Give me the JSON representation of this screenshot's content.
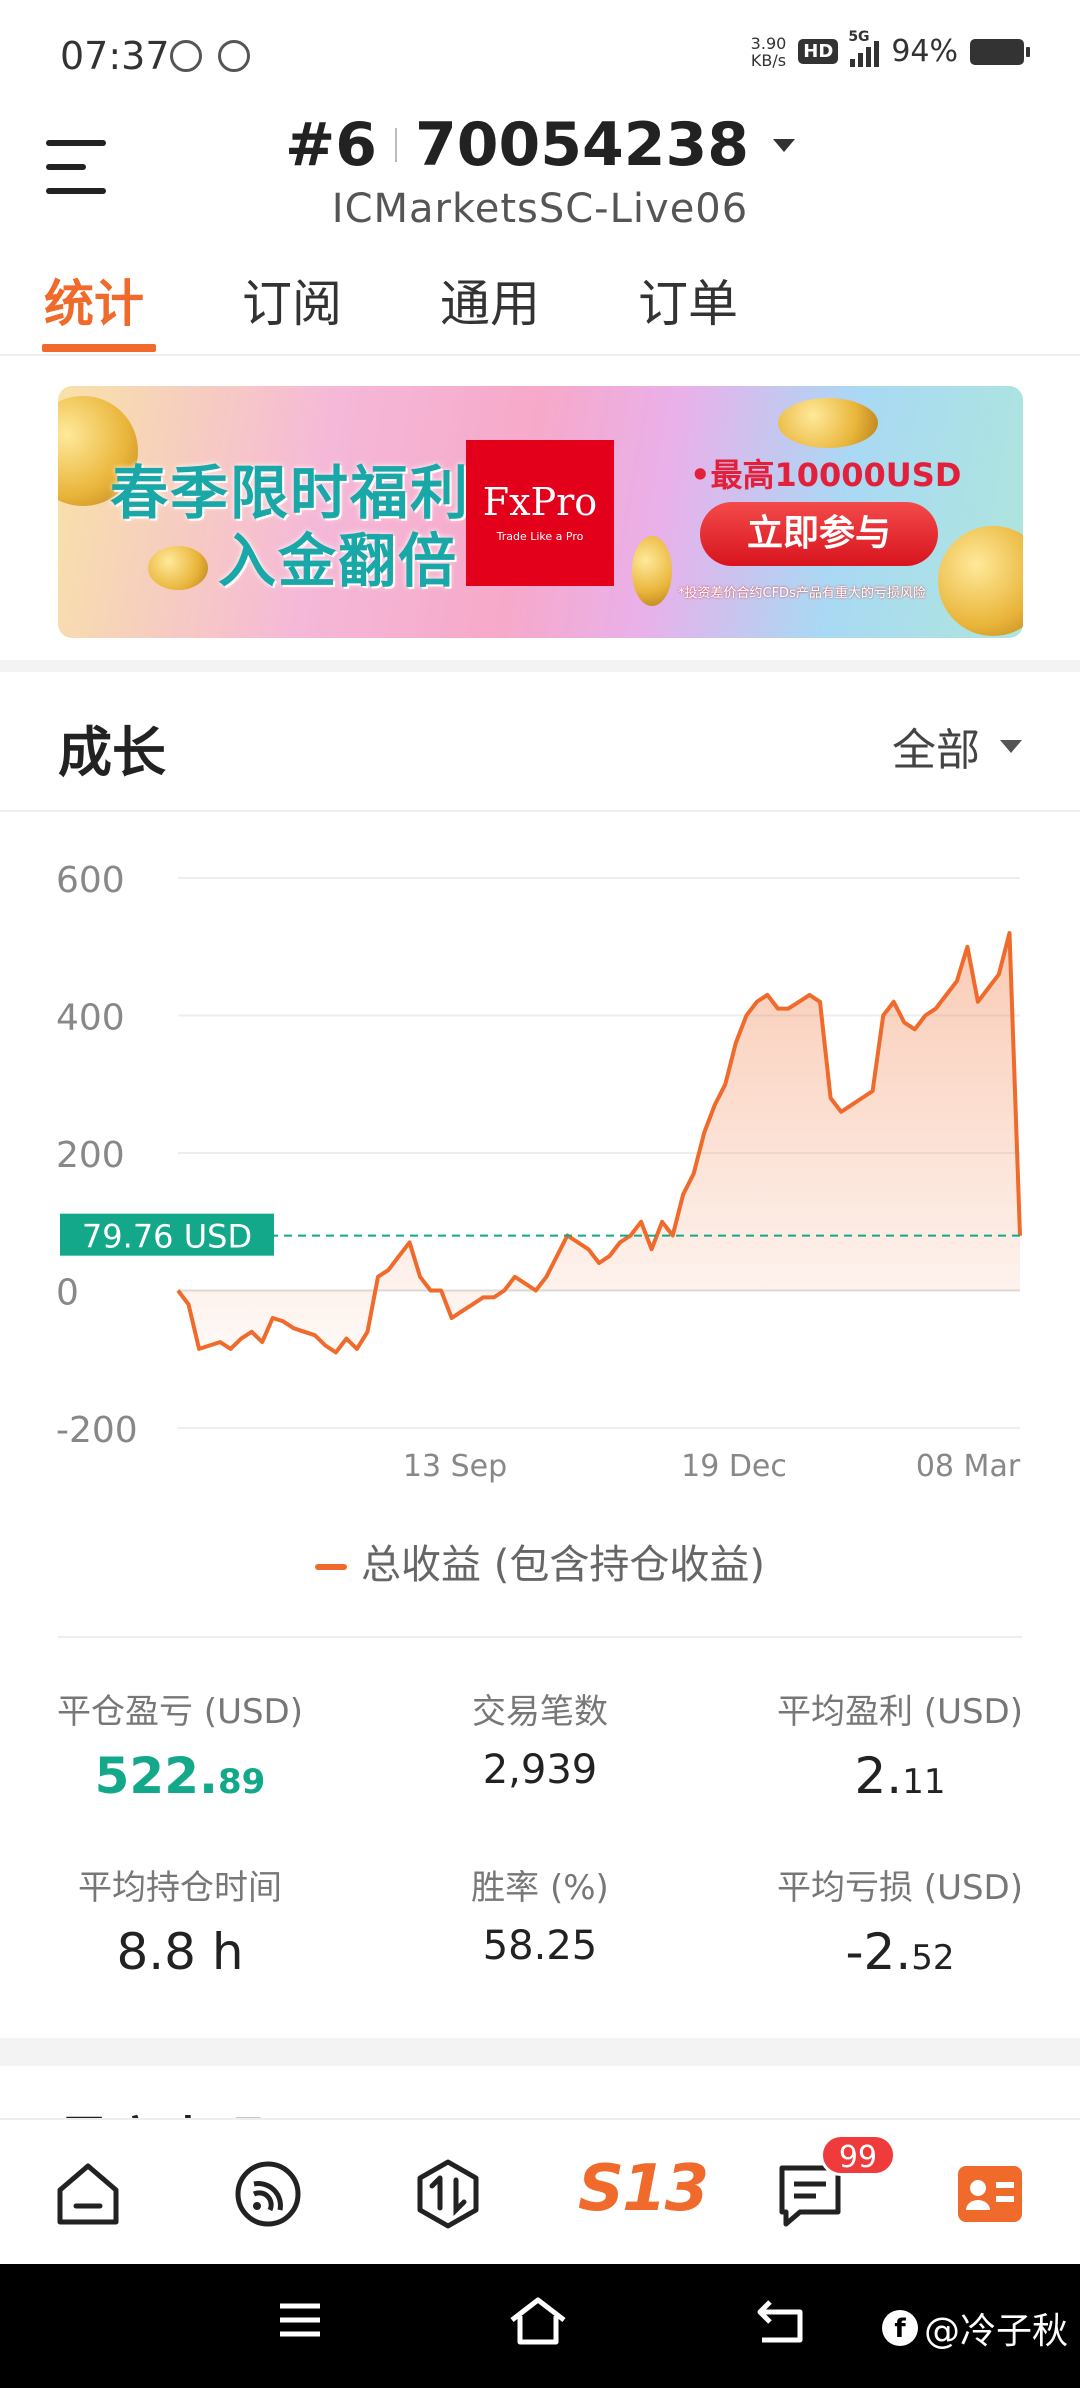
{
  "status_bar": {
    "time": "07:37",
    "net_speed_value": "3.90",
    "net_speed_unit": "KB/s",
    "hd": "HD",
    "network": "5G",
    "battery": "94%"
  },
  "header": {
    "account_prefix": "#6",
    "account_number": "70054238",
    "server": "ICMarketsSC-Live06"
  },
  "tabs": [
    {
      "label": "统计",
      "active": true
    },
    {
      "label": "订阅",
      "active": false
    },
    {
      "label": "通用",
      "active": false
    },
    {
      "label": "订单",
      "active": false
    }
  ],
  "banner": {
    "line1": "春季限时福利",
    "line2": "入金翻倍",
    "brand": "FxPro",
    "brand_tagline": "Trade Like a Pro",
    "promo_top": "•最高10000USD",
    "cta": "立即参与",
    "note": "*投资差价合约CFDs产品有重大的亏损风险"
  },
  "growth": {
    "title": "成长",
    "range": "全部"
  },
  "chart_data": {
    "type": "area",
    "y_ticks": [
      "600",
      "400",
      "200",
      "0",
      "-200"
    ],
    "ylim": [
      -200,
      600
    ],
    "x_ticks": [
      "13 Sep",
      "19 Dec",
      "08 Mar"
    ],
    "current_label": "79.76 USD",
    "current_value": 79.76,
    "series": [
      {
        "name": "总收益 (包含持仓收益)",
        "color": "#ef6a2b",
        "values": [
          0,
          -20,
          -85,
          -80,
          -75,
          -85,
          -70,
          -60,
          -75,
          -40,
          -45,
          -55,
          -60,
          -65,
          -80,
          -90,
          -70,
          -85,
          -60,
          20,
          30,
          50,
          70,
          20,
          0,
          0,
          -40,
          -30,
          -20,
          -10,
          -10,
          0,
          20,
          10,
          0,
          20,
          50,
          80,
          70,
          60,
          40,
          50,
          70,
          80,
          100,
          60,
          100,
          80,
          140,
          170,
          230,
          270,
          300,
          360,
          400,
          420,
          430,
          410,
          410,
          420,
          430,
          420,
          280,
          260,
          270,
          280,
          290,
          400,
          420,
          390,
          380,
          400,
          410,
          430,
          450,
          500,
          420,
          440,
          460,
          520,
          79.76
        ]
      }
    ]
  },
  "stats": {
    "closed_pnl_label": "平仓盈亏 (USD)",
    "closed_pnl_int": "522.",
    "closed_pnl_dec": "89",
    "trades_label": "交易笔数",
    "trades_value": "2,939",
    "avg_profit_label": "平均盈利 (USD)",
    "avg_profit_int": "2.",
    "avg_profit_dec": "11",
    "avg_hold_label": "平均持仓时间",
    "avg_hold_value": "8.8 h",
    "win_rate_label": "胜率 (%)",
    "win_rate_value": "58.25",
    "avg_loss_label": "平均亏损 (USD)",
    "avg_loss_int": "-2.",
    "avg_loss_dec": "52"
  },
  "next_section_title": "最高表现",
  "bottom_nav": {
    "brand": "S13",
    "badge": "99"
  },
  "watermark": "@冷子秋"
}
